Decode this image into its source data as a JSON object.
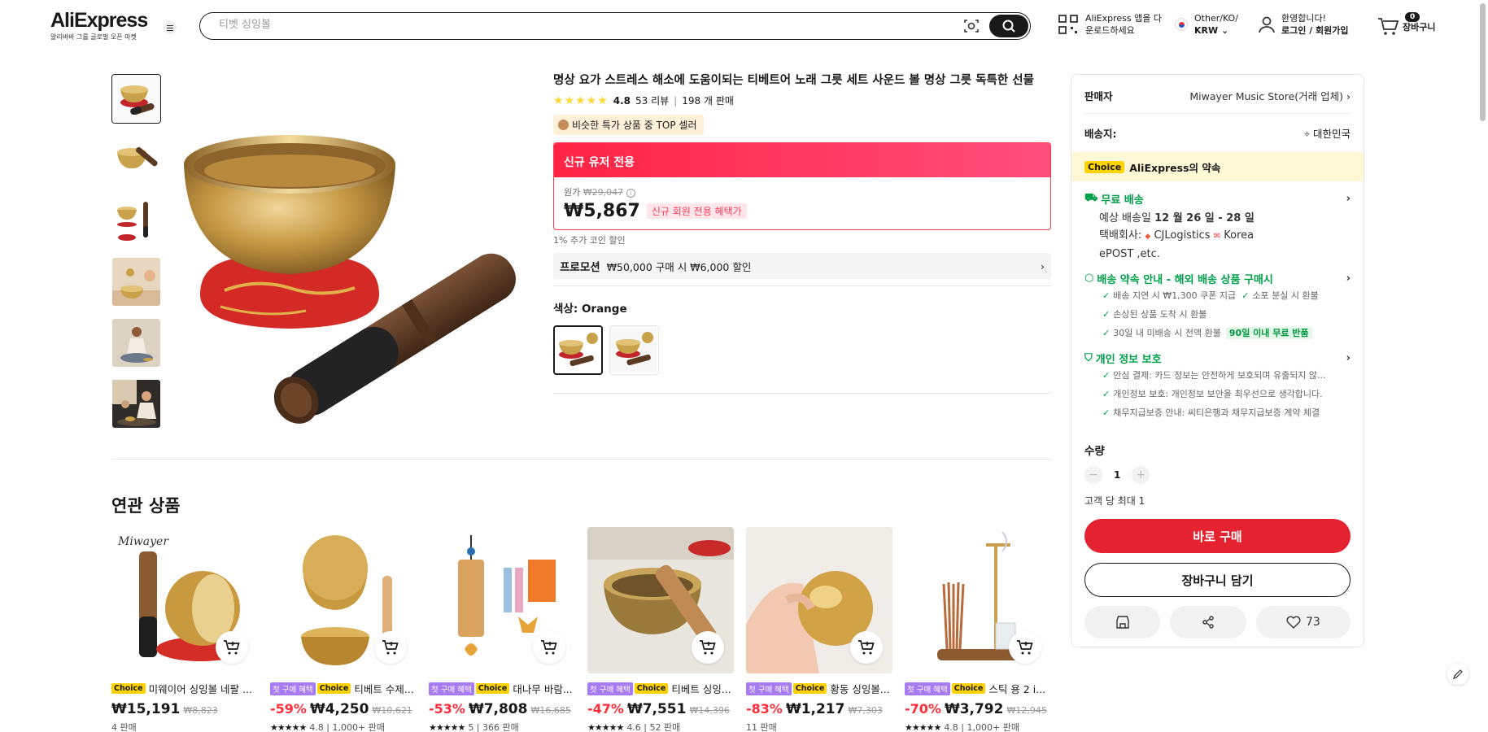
{
  "header": {
    "logo": "AliExpress",
    "logo_sub": "알리바바 그룹 글로벌 오픈 마켓",
    "search_placeholder": "티벳 싱잉볼",
    "app_line1": "AliExpress 앱을 다",
    "app_line2": "운로드하세요",
    "region_line1": "Other/KO/",
    "region_line2": "KRW",
    "account_line1": "환영합니다!",
    "account_line2": "로그인 / 회원가입",
    "cart_count": "0",
    "cart_label": "장바구니"
  },
  "product": {
    "title": "명상 요가 스트레스 해소에 도움이되는 티베트어 노래 그릇 세트 사운드 볼 명상 그릇 독특한 선물",
    "stars": "★★★★★",
    "rating": "4.8",
    "reviews": "53 리뷰",
    "sold": "198 개 판매",
    "top_seller": "비슷한 특가 상품 중 TOP 셀러",
    "new_user_banner": "신규 유저 전용",
    "orig_label": "원가",
    "orig_price": "₩29,047",
    "price": "₩5,867",
    "newbie_tag": "신규 회원 전용 혜택가",
    "coin": "1% 추가 코인 할인",
    "promo_label": "프로모션",
    "promo_text": "₩50,000 구매 시 ₩6,000 할인",
    "color_label": "색상: Orange"
  },
  "panel": {
    "seller_label": "판매자",
    "seller_name": "Miwayer Music Store(거래 업체)",
    "ship_label": "배송지:",
    "ship_to": "대한민국",
    "choice_tag": "Choice",
    "choice_promise": "AliExpress의 약속",
    "free_ship": "무료 배송",
    "eta_prefix": "예상 배송일",
    "eta": "12 월 26 일 - 28 일",
    "carrier_label": "택배회사:",
    "carrier1": "CJLogistics",
    "carrier2": "Korea",
    "carrier3": "ePOST ,etc.",
    "guide_head": "배송 약속 안내 - 해외 배송 상품 구매시",
    "guide1": "배송 지연 시 ₩1,300 쿠폰 지급",
    "guide2": "소포 분실 시 환불",
    "guide3": "손상된 상품 도착 시 환불",
    "guide4": "30일 내 미배송 시 전액 환불",
    "guide4_pill": "90일 이내 무료 반품",
    "privacy_head": "개인 정보 보호",
    "privacy1": "안심 결제: 카드 정보는 안전하게 보호되며 유출되지 않...",
    "privacy2": "개인정보 보호: 개인정보 보안을 최우선으로 생각합니다.",
    "privacy3": "채무지급보증 안내: 씨티은행과 채무지급보증 계약 체결",
    "qty_label": "수량",
    "qty": "1",
    "qty_limit": "고객 당 최대 1",
    "buy_now": "바로 구매",
    "add_cart": "장바구니 담기",
    "wish_count": "73"
  },
  "related": {
    "title": "연관 상품",
    "items": [
      {
        "first": "",
        "choice": "Choice",
        "title": "미웨이어 싱잉볼 네팔 ...",
        "discount": "",
        "price": "₩15,191",
        "old": "₩8,823",
        "stars": "",
        "meta": "4 판매"
      },
      {
        "first": "첫 구매 혜택",
        "choice": "Choice",
        "title": "티베트 수제...",
        "discount": "-59%",
        "price": "₩4,250",
        "old": "₩10,621",
        "stars": "★★★★★",
        "meta": "4.8 | 1,000+ 판매"
      },
      {
        "first": "첫 구매 혜택",
        "choice": "Choice",
        "title": "대나무 바람...",
        "discount": "-53%",
        "price": "₩7,808",
        "old": "₩16,685",
        "stars": "★★★★★",
        "meta": "5 | 366 판매"
      },
      {
        "first": "첫 구매 혜택",
        "choice": "Choice",
        "title": "티베트 싱잉...",
        "discount": "-47%",
        "price": "₩7,551",
        "old": "₩14,396",
        "stars": "★★★★★",
        "meta": "4.6 | 52 판매"
      },
      {
        "first": "첫 구매 혜택",
        "choice": "Choice",
        "title": "황동 싱잉볼...",
        "discount": "-83%",
        "price": "₩1,217",
        "old": "₩7,303",
        "stars": "",
        "meta": "11 판매"
      },
      {
        "first": "첫 구매 혜택",
        "choice": "Choice",
        "title": "스틱 용 2 i...",
        "discount": "-70%",
        "price": "₩3,792",
        "old": "₩12,945",
        "stars": "★★★★★",
        "meta": "4.8 | 1,000+ 판매"
      }
    ]
  }
}
